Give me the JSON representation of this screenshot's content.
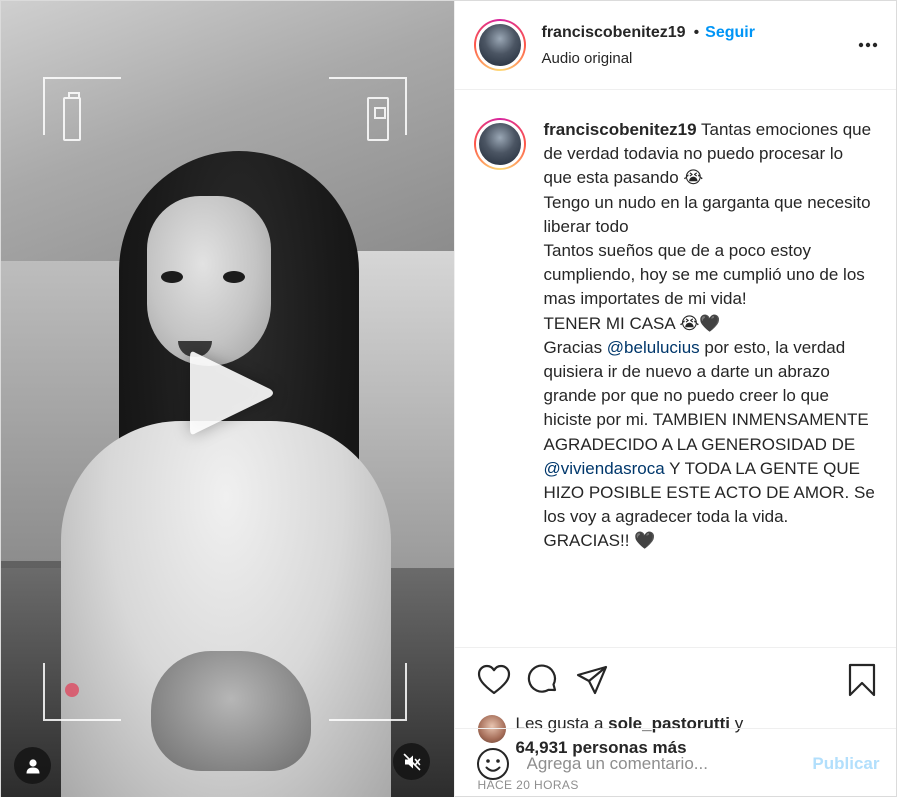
{
  "post": {
    "username": "franciscobenitez19",
    "separator": "•",
    "follow_label": "Seguir",
    "audio_label": "Audio original",
    "caption": {
      "username": "franciscobenitez19",
      "lines": [
        "Tantas emociones que de verdad todavia no puedo procesar lo que esta pasando 😭",
        "Tengo un nudo en la garganta que necesito liberar todo",
        "Tantos sueños que de a poco estoy cumpliendo, hoy se me cumplió uno de los mas importates de mi vida!",
        "TENER MI CASA 😭🖤"
      ],
      "thanks_prefix": "Gracias ",
      "mention_1": "@belulucius",
      "thanks_middle": " por esto, la verdad quisiera ir de nuevo a darte un abrazo grande por que no puedo creer lo que hiciste por mi. TAMBIEN INMENSAMENTE AGRADECIDO A LA GENEROSIDAD DE ",
      "mention_2": "@viviendasroca",
      "thanks_suffix": " Y TODA LA GENTE QUE HIZO POSIBLE ESTE ACTO DE AMOR. Se los voy a agradecer toda la vida. GRACIAS!! 🖤"
    },
    "likes": {
      "prefix": "Les gusta a ",
      "user": "sole_pastorutti",
      "middle": " y ",
      "count": "64,931 personas más"
    },
    "time_label": "HACE 20 HORAS",
    "comment": {
      "placeholder": "Agrega un comentario...",
      "publish_label": "Publicar"
    }
  },
  "icons": {
    "more": "more-options-icon",
    "like": "heart-icon",
    "comment": "comment-icon",
    "share": "send-icon",
    "save": "bookmark-icon",
    "emoji": "emoji-icon",
    "play": "play-icon",
    "user_tag": "user-icon",
    "mute": "muted-speaker-icon"
  },
  "colors": {
    "accent": "#0095f6",
    "mention": "#00376b",
    "publish_disabled": "#b2dffc",
    "muted_text": "#8e8e8e"
  }
}
